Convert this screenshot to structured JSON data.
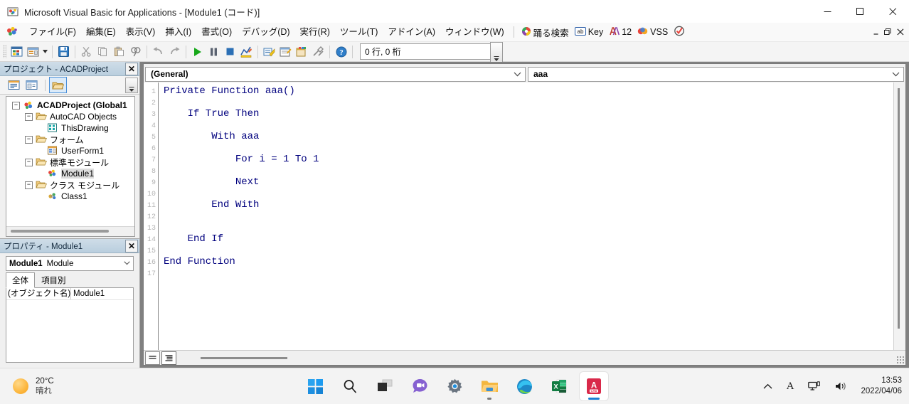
{
  "window": {
    "title": "Microsoft Visual Basic for Applications - [Module1 (コード)]",
    "app_icon": "vba-icon",
    "minimize_label": "—",
    "maximize_label": "□",
    "close_label": "✕"
  },
  "menubar": {
    "items": [
      {
        "label": "ファイル(F)",
        "accel": "F"
      },
      {
        "label": "編集(E)",
        "accel": "E"
      },
      {
        "label": "表示(V)",
        "accel": "V"
      },
      {
        "label": "挿入(I)",
        "accel": "I"
      },
      {
        "label": "書式(O)",
        "accel": "O"
      },
      {
        "label": "デバッグ(D)",
        "accel": "D"
      },
      {
        "label": "実行(R)",
        "accel": "R"
      },
      {
        "label": "ツール(T)",
        "accel": "T"
      },
      {
        "label": "アドイン(A)",
        "accel": "A"
      },
      {
        "label": "ウィンドウ(W)",
        "accel": "W"
      }
    ],
    "addins": [
      {
        "label": "踊る検索",
        "icon": "colorful-circle-icon"
      },
      {
        "label": "Key",
        "icon": "ab-box-icon"
      },
      {
        "label": "12",
        "icon": "double-a-icon"
      },
      {
        "label": "VSS",
        "icon": "vss-icon"
      },
      {
        "label": "",
        "icon": "check-circle-icon"
      }
    ],
    "mdi_controls": {
      "minimize": "–",
      "restore": "❐",
      "close": "✕"
    }
  },
  "toolbar": {
    "buttons": [
      {
        "name": "view-excel-icon",
        "tooltip": "表示 Microsoft Excel"
      },
      {
        "name": "insert-userform-icon",
        "tooltip": "ユーザーフォームの挿入"
      },
      {
        "name": "save-icon",
        "tooltip": "上書き保存"
      },
      {
        "name": "cut-icon",
        "tooltip": "切り取り"
      },
      {
        "name": "copy-icon",
        "tooltip": "コピー"
      },
      {
        "name": "paste-icon",
        "tooltip": "貼り付け"
      },
      {
        "name": "find-icon",
        "tooltip": "検索"
      },
      {
        "name": "undo-icon",
        "tooltip": "元に戻す"
      },
      {
        "name": "redo-icon",
        "tooltip": "やり直し"
      },
      {
        "name": "run-icon",
        "tooltip": "Sub/ユーザーフォームの実行"
      },
      {
        "name": "pause-icon",
        "tooltip": "中断"
      },
      {
        "name": "stop-icon",
        "tooltip": "リセット"
      },
      {
        "name": "design-mode-icon",
        "tooltip": "デザインモード"
      },
      {
        "name": "project-explorer-icon",
        "tooltip": "プロジェクト エクスプローラー"
      },
      {
        "name": "properties-window-icon",
        "tooltip": "プロパティ ウィンドウ"
      },
      {
        "name": "object-browser-icon",
        "tooltip": "オブジェクト ブラウザー"
      },
      {
        "name": "toolbox-icon",
        "tooltip": "ツールボックス"
      },
      {
        "name": "help-icon",
        "tooltip": "ヘルプ"
      }
    ],
    "position_value": "0 行, 0 桁"
  },
  "project_panel": {
    "caption": "プロジェクト - ACADProject",
    "close_label": "✕",
    "toolbar": [
      {
        "name": "view-code-icon"
      },
      {
        "name": "view-object-icon"
      },
      {
        "name": "toggle-folders-icon",
        "active": true
      }
    ],
    "tree": [
      {
        "label": "ACADProject (Global1",
        "level": 0,
        "icon": "project-icon",
        "expander": "−",
        "bold": true,
        "selected": false
      },
      {
        "label": "AutoCAD Objects",
        "level": 1,
        "icon": "folder-icon",
        "expander": "−",
        "bold": false,
        "selected": false
      },
      {
        "label": "ThisDrawing",
        "level": 2,
        "icon": "drawing-icon",
        "expander": "",
        "bold": false,
        "selected": false
      },
      {
        "label": "フォーム",
        "level": 1,
        "icon": "folder-icon",
        "expander": "−",
        "bold": false,
        "selected": false
      },
      {
        "label": "UserForm1",
        "level": 2,
        "icon": "userform-icon",
        "expander": "",
        "bold": false,
        "selected": false
      },
      {
        "label": "標準モジュール",
        "level": 1,
        "icon": "folder-icon",
        "expander": "−",
        "bold": false,
        "selected": false
      },
      {
        "label": "Module1",
        "level": 2,
        "icon": "module-icon",
        "expander": "",
        "bold": false,
        "selected": true
      },
      {
        "label": "クラス モジュール",
        "level": 1,
        "icon": "folder-icon",
        "expander": "−",
        "bold": false,
        "selected": false
      },
      {
        "label": "Class1",
        "level": 2,
        "icon": "class-icon",
        "expander": "",
        "bold": false,
        "selected": false
      }
    ]
  },
  "properties_panel": {
    "caption": "プロパティ - Module1",
    "close_label": "✕",
    "combo_name": "Module1",
    "combo_type": "Module",
    "combo_arrow": "⌄",
    "tabs": [
      {
        "label": "全体",
        "active": true
      },
      {
        "label": "項目別",
        "active": false
      }
    ],
    "rows": [
      {
        "key": "(オブジェクト名)",
        "value": "Module1"
      }
    ]
  },
  "code_window": {
    "object_combo": "(General)",
    "proc_combo": "aaa",
    "combo_arrow": "⌄",
    "line_numbers": [
      "1",
      "2",
      "3",
      "4",
      "5",
      "6",
      "7",
      "8",
      "9",
      "10",
      "11",
      "12",
      "13",
      "14",
      "15",
      "16",
      "17"
    ],
    "lines": [
      "Private Function aaa()",
      "",
      "    If True Then",
      "",
      "        With aaa",
      "",
      "            For i = 1 To 1",
      "",
      "            Next",
      "",
      "        End With",
      "",
      "",
      "    End If",
      "",
      "End Function",
      ""
    ],
    "view_buttons": [
      {
        "name": "procedure-view-button",
        "active": false
      },
      {
        "name": "full-module-view-button",
        "active": true
      }
    ],
    "code_color": "#00007e"
  },
  "taskbar": {
    "weather": {
      "temperature": "20°C",
      "condition": "晴れ",
      "icon": "sun-icon"
    },
    "apps": [
      {
        "name": "start-button",
        "icon": "windows-logo-icon",
        "active": false,
        "running": false
      },
      {
        "name": "search-button",
        "icon": "search-icon",
        "active": false,
        "running": false
      },
      {
        "name": "task-view-button",
        "icon": "task-view-icon",
        "active": false,
        "running": false
      },
      {
        "name": "chat-button",
        "icon": "chat-icon",
        "active": false,
        "running": false
      },
      {
        "name": "settings-button",
        "icon": "gear-icon",
        "active": false,
        "running": false
      },
      {
        "name": "file-explorer-button",
        "icon": "folder-icon",
        "active": false,
        "running": true
      },
      {
        "name": "edge-button",
        "icon": "edge-icon",
        "active": false,
        "running": false
      },
      {
        "name": "excel-button",
        "icon": "excel-icon",
        "active": false,
        "running": false
      },
      {
        "name": "autocad-button",
        "icon": "autocad-icon",
        "active": true,
        "running": true
      }
    ],
    "tray": [
      {
        "name": "show-hidden-icons",
        "glyph": "⌃"
      },
      {
        "name": "ime-indicator",
        "glyph": "A"
      },
      {
        "name": "network-icon",
        "glyph": "network"
      },
      {
        "name": "volume-icon",
        "glyph": "volume"
      }
    ],
    "clock": {
      "time": "13:53",
      "date": "2022/04/06"
    }
  }
}
